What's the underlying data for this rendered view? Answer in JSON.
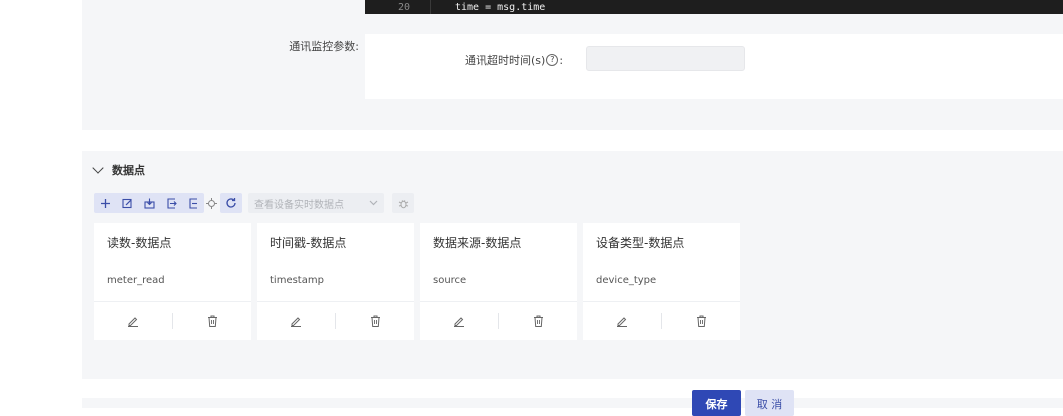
{
  "code": {
    "line_number": "20",
    "line_text": "time = msg.time"
  },
  "comm_monitor": {
    "label": "通讯监控参数:",
    "timeout_label": "通讯超时时间(s)",
    "help_glyph": "?",
    "colon": ":",
    "timeout_value": ""
  },
  "datapoints": {
    "section_title": "数据点",
    "toolbar": {
      "select_placeholder": "查看设备实时数据点",
      "icons": [
        "plus-icon",
        "edit-icon",
        "import-icon",
        "export-icon",
        "export-alt-icon",
        "locate-icon",
        "refresh-icon",
        "bug-icon"
      ]
    },
    "cards": [
      {
        "title": "读数-数据点",
        "key": "meter_read"
      },
      {
        "title": "时间戳-数据点",
        "key": "timestamp"
      },
      {
        "title": "数据来源-数据点",
        "key": "source"
      },
      {
        "title": "设备类型-数据点",
        "key": "device_type"
      }
    ]
  },
  "footer": {
    "save_label": "保存",
    "cancel_label": "取 消"
  },
  "colors": {
    "primary": "#2f48b5",
    "primary_light": "#dfe3f5",
    "panel_bg": "#f5f6f8"
  }
}
